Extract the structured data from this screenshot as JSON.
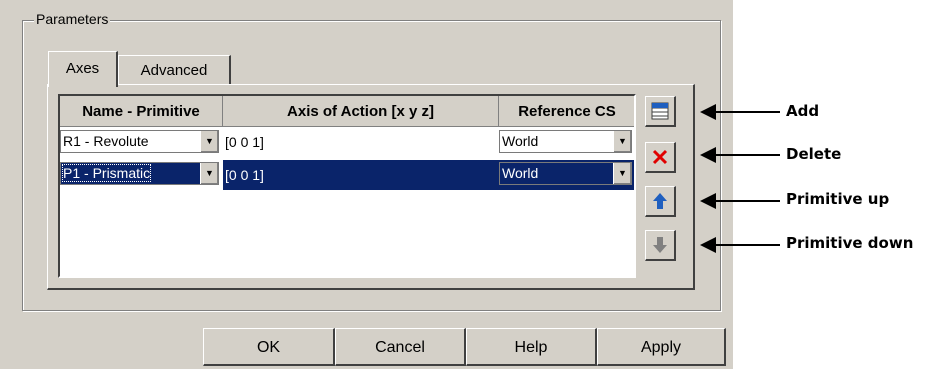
{
  "group": {
    "legend": "Parameters"
  },
  "tabs": [
    {
      "label": "Axes",
      "active": true
    },
    {
      "label": "Advanced",
      "active": false
    }
  ],
  "table": {
    "headers": [
      "Name - Primitive",
      "Axis of Action [x y z]",
      "Reference CS"
    ],
    "rows": [
      {
        "primitive": "R1 - Revolute",
        "axis": "[0 0 1]",
        "reference": "World",
        "selected": false
      },
      {
        "primitive": "P1 - Prismatic",
        "axis": "[0 0 1]",
        "reference": "World",
        "selected": true
      }
    ]
  },
  "side_buttons": [
    {
      "icon": "add-row-icon"
    },
    {
      "icon": "delete-icon",
      "color": "#e00000"
    },
    {
      "icon": "arrow-up-icon",
      "color": "#1f5fbf"
    },
    {
      "icon": "arrow-down-icon",
      "color": "#808080"
    }
  ],
  "buttons": {
    "ok": "OK",
    "cancel": "Cancel",
    "help": "Help",
    "apply": "Apply"
  },
  "annotations": [
    "Add",
    "Delete",
    "Primitive up",
    "Primitive down"
  ],
  "colors": {
    "selection": "#0a246a",
    "dialog_bg": "#d4d0c8"
  }
}
